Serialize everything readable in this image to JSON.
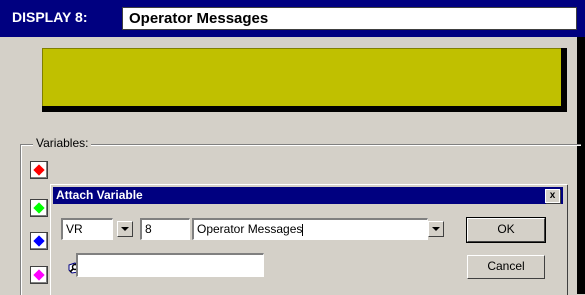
{
  "display": {
    "label": "DISPLAY 8:",
    "name": "Operator Messages"
  },
  "variables": {
    "legend": "Variables:",
    "swatches": [
      {
        "color": "#ff0000"
      },
      {
        "color": "#00ff00"
      },
      {
        "color": "#0000ff"
      },
      {
        "color": "#ff00ff"
      }
    ]
  },
  "lcd_color": "#c0c000",
  "dialog": {
    "title": "Attach Variable",
    "close_glyph": "x",
    "type_value": "VR",
    "index_value": "8",
    "variable_name": "Operator Messages",
    "search_value": "",
    "ok_label": "OK",
    "cancel_label": "Cancel"
  }
}
